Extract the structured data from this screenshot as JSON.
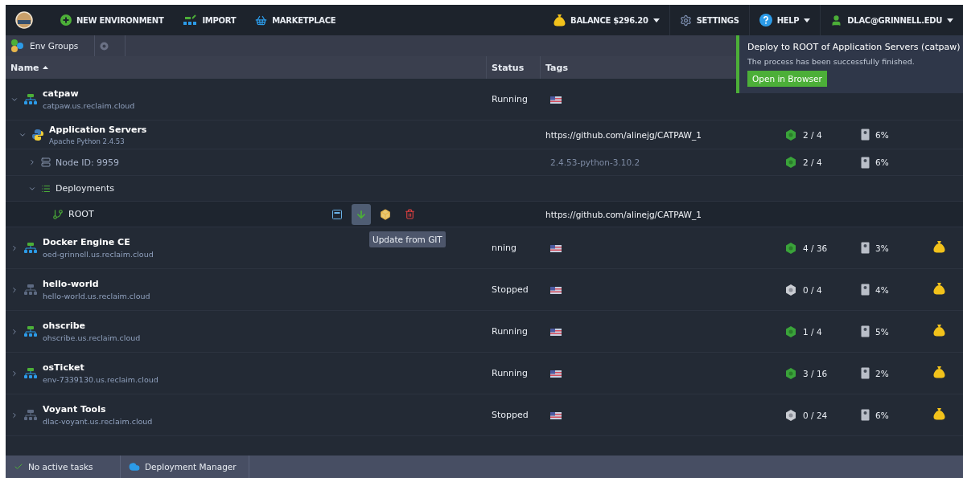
{
  "topbar": {
    "items": [
      {
        "kind": "new",
        "label": "NEW ENVIRONMENT"
      },
      {
        "kind": "import",
        "label": "IMPORT"
      },
      {
        "kind": "market",
        "label": "MARKETPLACE"
      }
    ],
    "right": [
      {
        "kind": "balance",
        "label": "BALANCE $296.20",
        "dropdown": true
      },
      {
        "kind": "settings",
        "label": "SETTINGS",
        "dropdown": false
      },
      {
        "kind": "help",
        "label": "HELP",
        "dropdown": true
      },
      {
        "kind": "user",
        "label": "DLAC@GRINNELL.EDU",
        "dropdown": true
      }
    ]
  },
  "breadcrumb": {
    "label": "Env Groups"
  },
  "columns": [
    {
      "label": "Name",
      "sorted": true
    },
    {
      "label": "Status",
      "sorted": false
    },
    {
      "label": "Tags",
      "sorted": false
    }
  ],
  "envs": [
    {
      "name": "catpaw",
      "domain": "catpaw.us.reclaim.cloud",
      "status": "Running",
      "active": true,
      "expanded": true,
      "children": [
        {
          "kind": "layer",
          "name": "Application Servers",
          "subtitle": "Apache Python 2.4.53",
          "tag": "https://github.com/alinejg/CATPAW_1",
          "cloudlets": "2 / 4",
          "disk": "6%",
          "expanded": true,
          "children": [
            {
              "kind": "node",
              "name": "Node ID: 9959",
              "tag": "2.4.53-python-3.10.2",
              "cloudlets": "2 / 4",
              "disk": "6%",
              "expanded": false
            },
            {
              "kind": "group",
              "name": "Deployments",
              "expanded": true,
              "children": [
                {
                  "kind": "deployment",
                  "name": "ROOT",
                  "tag": "https://github.com/alinejg/CATPAW_1",
                  "actions": [
                    {
                      "kind": "config",
                      "hovered": false
                    },
                    {
                      "kind": "update",
                      "hovered": true
                    },
                    {
                      "kind": "package",
                      "hovered": false
                    },
                    {
                      "kind": "delete",
                      "hovered": false
                    }
                  ],
                  "tooltip": "Update from GIT"
                }
              ]
            }
          ]
        }
      ]
    },
    {
      "name": "Docker Engine CE",
      "domain": "oed-grinnell.us.reclaim.cloud",
      "status": "nning",
      "active": true,
      "expanded": false,
      "cloudlets": "4 / 36",
      "disk": "3%"
    },
    {
      "name": "hello-world",
      "domain": "hello-world.us.reclaim.cloud",
      "status": "Stopped",
      "active": false,
      "expanded": false,
      "cloudlets": "0 / 4",
      "disk": "4%"
    },
    {
      "name": "ohscribe",
      "domain": "ohscribe.us.reclaim.cloud",
      "status": "Running",
      "active": true,
      "expanded": false,
      "cloudlets": "1 / 4",
      "disk": "5%"
    },
    {
      "name": "osTicket",
      "domain": "env-7339130.us.reclaim.cloud",
      "status": "Running",
      "active": true,
      "expanded": false,
      "cloudlets": "3 / 16",
      "disk": "2%"
    },
    {
      "name": "Voyant Tools",
      "domain": "dlac-voyant.us.reclaim.cloud",
      "status": "Stopped",
      "active": false,
      "expanded": false,
      "cloudlets": "0 / 24",
      "disk": "6%"
    }
  ],
  "toast": {
    "title": "Deploy to ROOT of Application Servers (catpaw)",
    "message": "The process has been successfully finished.",
    "button": "Open in Browser"
  },
  "status_bar": {
    "tasks": "No active tasks",
    "manager": "Deployment Manager"
  }
}
